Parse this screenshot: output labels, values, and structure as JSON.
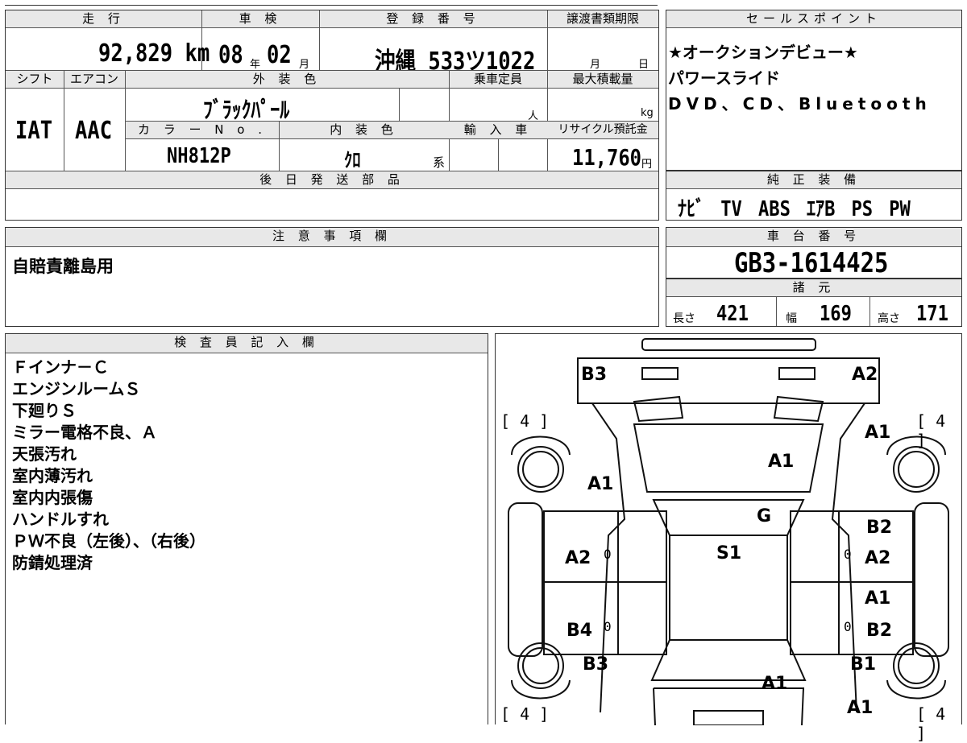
{
  "top_grid": {
    "labels": {
      "mileage": "走 行",
      "inspection": "車 検",
      "registration": "登 録 番 号",
      "transfer_deadline": "譲渡書類期限",
      "shift": "シフト",
      "aircon": "エアコン",
      "exterior_color": "外 装 色",
      "capacity": "乗車定員",
      "max_load": "最大積載量",
      "color_no": "カ ラ ー N o .",
      "interior_color": "内 装 色",
      "import": "輸 入 車",
      "recycle_fee": "リサイクル預託金",
      "later_parts": "後 日 発 送 部 品"
    },
    "mileage_value": "92,829 km",
    "inspection_year": "08",
    "inspection_year_unit": "年",
    "inspection_month": "02",
    "inspection_month_unit": "月",
    "registration_number": "沖縄 533ツ1022",
    "deadline_month_unit": "月",
    "deadline_day_unit": "日",
    "shift_value": "IAT",
    "aircon_value": "AAC",
    "exterior_color_value": "ﾌﾞﾗｯｸﾊﾟｰﾙ",
    "capacity_unit": "人",
    "max_load_unit": "kg",
    "color_no_value": "NH812P",
    "interior_color_value": "ｸﾛ",
    "interior_color_unit": "系",
    "recycle_fee_value": "11,760",
    "recycle_fee_unit": "円"
  },
  "sales_points": {
    "header": "セールスポイント",
    "lines": [
      "★オークションデビュー★",
      "パワースライド",
      "DVD、CD、Bluetooth"
    ]
  },
  "genuine_equipment": {
    "header": "純 正 装 備",
    "value": "ﾅﾋﾞ TV ABS ｴｱB PS PW"
  },
  "notes": {
    "header": "注 意 事 項 欄",
    "value": "自賠責離島用"
  },
  "chassis": {
    "header": "車 台 番 号",
    "value": "GB3-1614425"
  },
  "specs": {
    "header": "諸 元",
    "length_label": "長さ",
    "length_value": "421",
    "width_label": "幅",
    "width_value": "169",
    "height_label": "高さ",
    "height_value": "171"
  },
  "inspector": {
    "header": "検 査 員 記 入 欄",
    "lines": [
      "Ｆインナ－Ｃ",
      "エンジンルームＳ",
      "下廻りＳ",
      "ミラー電格不良、Ａ",
      "天張汚れ",
      "室内薄汚れ",
      "室内内張傷",
      "ハンドルすれ",
      "ＰＷ不良（左後）、（右後）",
      "防錆処理済"
    ]
  },
  "diagram": {
    "tire_brackets": [
      "[ 4 ]",
      "[ 4 ]",
      "[ 4 ]",
      "[ 4 ]"
    ],
    "marks": {
      "front_left": "B3",
      "front_right": "A2",
      "fender_right": "A1",
      "hood": "A1",
      "fender_left": "A1",
      "glass": "G",
      "front_door_right_top": "B2",
      "roof": "S1",
      "front_door_left": "A2",
      "front_door_right": "A2",
      "rear_door_right_top": "A1",
      "rear_door_left": "B4",
      "rear_door_right": "B2",
      "rear_left": "B3",
      "rear_right": "B1",
      "trunk": "A1",
      "rear_bumper_right": "A1",
      "zero_1": "0",
      "zero_2": "0",
      "zero_3": "0",
      "zero_4": "0"
    }
  }
}
